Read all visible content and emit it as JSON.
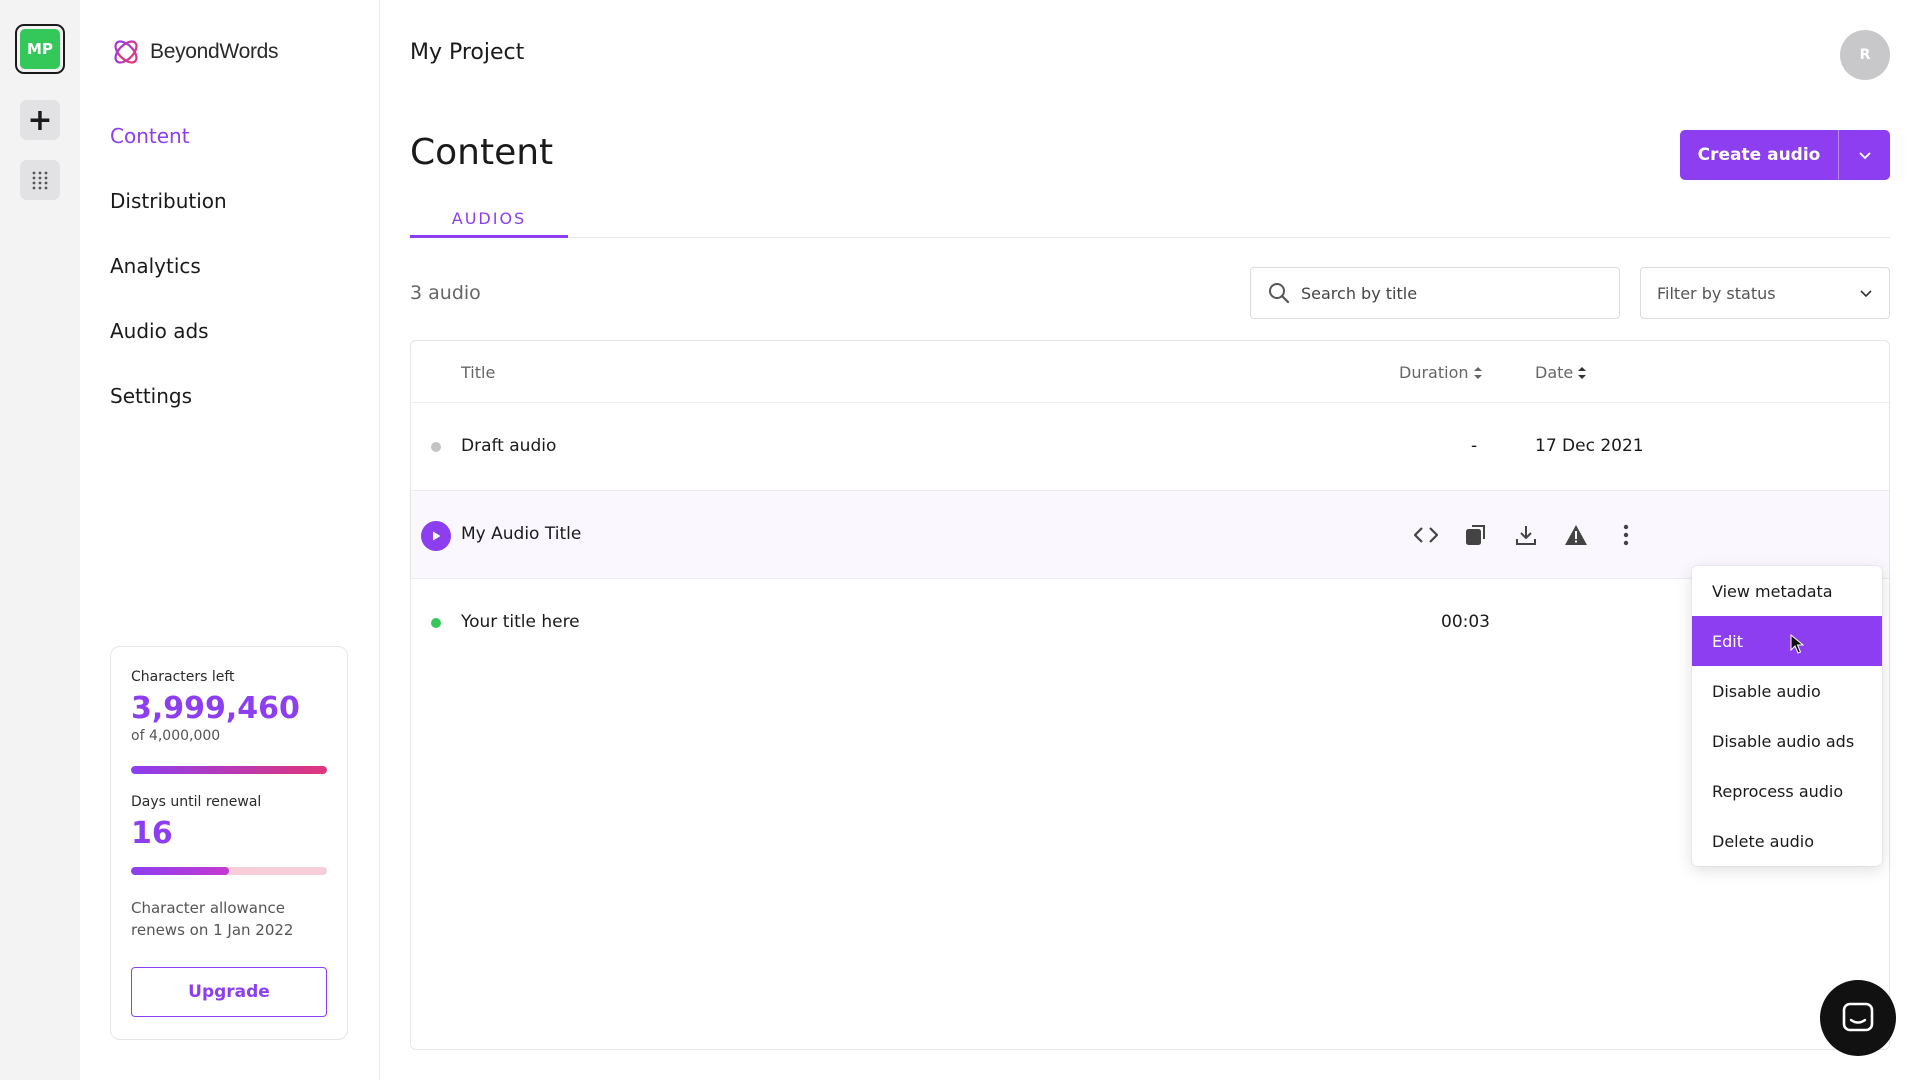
{
  "rail": {
    "project_initials": "MP",
    "add_icon": "plus-icon",
    "grid_icon": "grid-dots-icon"
  },
  "brand": {
    "name": "BeyondWords",
    "accent": "#8c3ef0",
    "logo_icon": "beyondwords-logo"
  },
  "nav": {
    "items": [
      {
        "label": "Content",
        "active": true
      },
      {
        "label": "Distribution",
        "active": false
      },
      {
        "label": "Analytics",
        "active": false
      },
      {
        "label": "Audio ads",
        "active": false
      },
      {
        "label": "Settings",
        "active": false
      }
    ]
  },
  "usage": {
    "characters_label": "Characters left",
    "characters_left": "3,999,460",
    "characters_total": "of 4,000,000",
    "characters_fraction": 0.9999,
    "days_label": "Days until renewal",
    "days_left": "16",
    "days_fraction": 0.5,
    "renew_text": "Character allowance renews on 1 Jan 2022",
    "upgrade_label": "Upgrade"
  },
  "header": {
    "project_name": "My Project",
    "avatar_initial": "R"
  },
  "main": {
    "title": "Content",
    "create_label": "Create audio",
    "tabs": [
      {
        "label": "AUDIOS",
        "active": true
      }
    ],
    "count": "3 audio",
    "search_placeholder": "Search by title",
    "filter_placeholder": "Filter by status"
  },
  "table": {
    "columns": {
      "title": "Title",
      "duration": "Duration",
      "date": "Date"
    },
    "rows": [
      {
        "title": "Draft audio",
        "duration": "-",
        "date": "17 Dec 2021",
        "status_color": "#c4c4c8"
      },
      {
        "title": "My Audio Title",
        "duration": "",
        "date": "",
        "status_color": "#8c3ef0"
      },
      {
        "title": "Your title here",
        "duration": "00:03",
        "date": "",
        "status_color": "#34c759"
      }
    ],
    "row_action_icons": [
      "embed-code-icon",
      "copy-icon",
      "download-icon",
      "warning-icon",
      "more-vertical-icon"
    ]
  },
  "context_menu": {
    "items": [
      {
        "label": "View metadata",
        "selected": false
      },
      {
        "label": "Edit",
        "selected": true
      },
      {
        "label": "Disable audio",
        "selected": false
      },
      {
        "label": "Disable audio ads",
        "selected": false
      },
      {
        "label": "Reprocess audio",
        "selected": false
      },
      {
        "label": "Delete audio",
        "selected": false
      }
    ]
  },
  "chat": {
    "icon": "chat-bubble-icon"
  }
}
